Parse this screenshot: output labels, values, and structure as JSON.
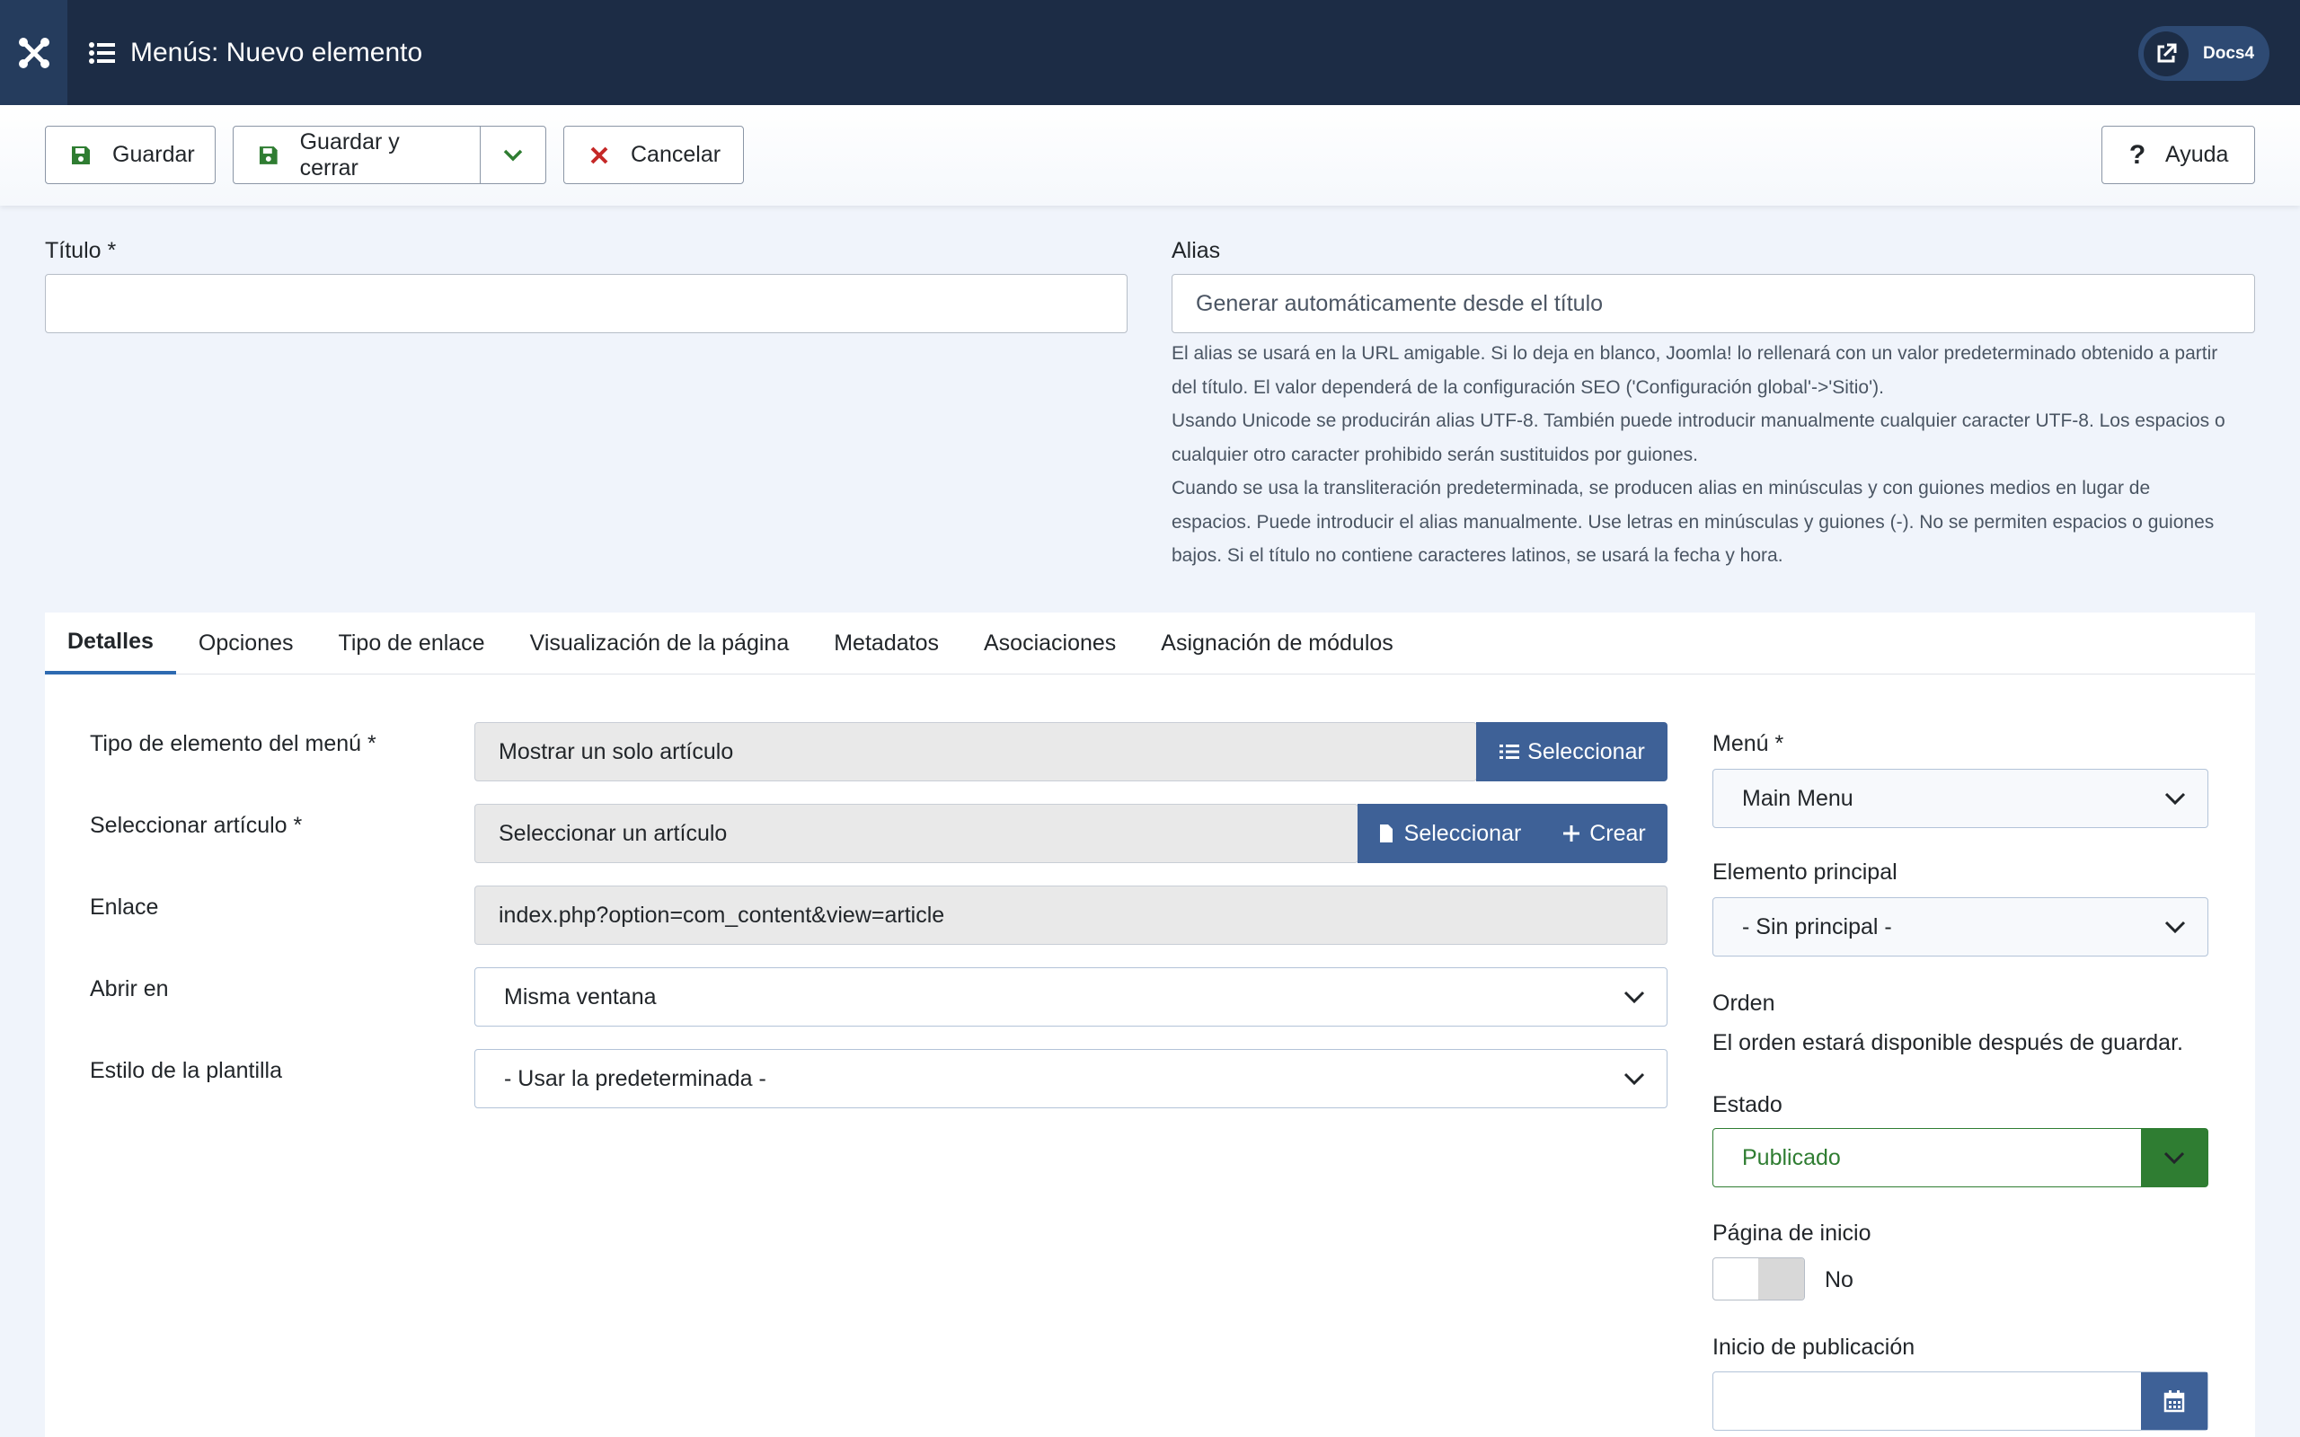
{
  "header": {
    "title": "Menús: Nuevo elemento",
    "docs_label": "Docs4"
  },
  "toolbar": {
    "save_label": "Guardar",
    "save_close_label": "Guardar y cerrar",
    "cancel_label": "Cancelar",
    "help_label": "Ayuda"
  },
  "form": {
    "title_label": "Título *",
    "title_value": "",
    "alias_label": "Alias",
    "alias_placeholder": "Generar automáticamente desde el título",
    "alias_help": [
      "El alias se usará en la URL amigable. Si lo deja en blanco, Joomla! lo rellenará con un valor predeterminado obtenido a partir",
      "del título. El valor dependerá de la configuración SEO ('Configuración global'->'Sitio').",
      "Usando Unicode se producirán alias UTF-8. También puede introducir manualmente cualquier caracter UTF-8. Los espacios o",
      "cualquier otro caracter prohibido serán sustituidos por guiones.",
      "Cuando se usa la transliteración predeterminada, se producen alias en minúsculas y con guiones medios en lugar de",
      "espacios. Puede introducir el alias manualmente. Use letras en minúsculas y guiones (-). No se permiten espacios o guiones",
      "bajos. Si el título no contiene caracteres latinos, se usará la fecha y hora."
    ]
  },
  "tabs": [
    {
      "label": "Detalles"
    },
    {
      "label": "Opciones"
    },
    {
      "label": "Tipo de enlace"
    },
    {
      "label": "Visualización de la página"
    },
    {
      "label": "Metadatos"
    },
    {
      "label": "Asociaciones"
    },
    {
      "label": "Asignación de módulos"
    }
  ],
  "details": {
    "menu_item_type_label": "Tipo de elemento del menú *",
    "menu_item_type_value": "Mostrar un solo artículo",
    "select_label": "Seleccionar",
    "select_article_label": "Seleccionar artículo *",
    "select_article_value": "Seleccionar un artículo",
    "create_label": "Crear",
    "link_label": "Enlace",
    "link_value": "index.php?option=com_content&view=article",
    "open_in_label": "Abrir en",
    "open_in_value": "Misma ventana",
    "template_style_label": "Estilo de la plantilla",
    "template_style_value": "- Usar la predeterminada -"
  },
  "sidebar": {
    "menu_label": "Menú *",
    "menu_value": "Main Menu",
    "parent_label": "Elemento principal",
    "parent_value": "- Sin principal -",
    "order_label": "Orden",
    "order_text": "El orden estará disponible después de guardar.",
    "status_label": "Estado",
    "status_value": "Publicado",
    "home_label": "Página de inicio",
    "home_value": "No",
    "publish_start_label": "Inicio de publicación"
  },
  "colors": {
    "header_bg": "#1c2c45",
    "accent_blue": "#3e6197",
    "published_green": "#2f7d32",
    "save_icon_green": "#2f7d32",
    "cancel_icon_red": "#c52827"
  }
}
